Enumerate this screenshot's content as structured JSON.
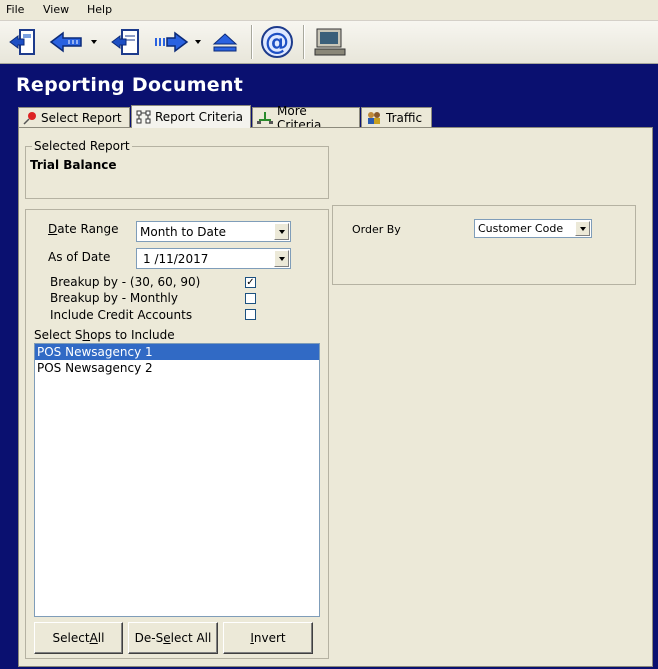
{
  "menu": [
    {
      "label": "File"
    },
    {
      "label": "View"
    },
    {
      "label": "Help"
    }
  ],
  "toolbar": {
    "icons": [
      "exit-icon",
      "back-icon",
      "dropdown-icon",
      "save-icon",
      "forward-icon",
      "dropdown-icon",
      "eject-icon",
      "email-icon",
      "monitor-icon"
    ]
  },
  "window": {
    "title": "Reporting Document"
  },
  "tabs": [
    {
      "label": "Select Report",
      "icon": "pin-icon",
      "active": false
    },
    {
      "label": "Report Criteria",
      "icon": "structure-icon",
      "active": true
    },
    {
      "label": "More Criteria",
      "icon": "tree-icon",
      "active": false
    },
    {
      "label": "Traffic",
      "icon": "people-icon",
      "active": false
    }
  ],
  "selected_report": {
    "group_label": "Selected Report",
    "value": "Trial Balance"
  },
  "criteria": {
    "date_range_label": "Date Range",
    "date_range_value": "Month to Date",
    "as_of_date_label": "As of Date",
    "as_of_date_value": "1 /11/2017",
    "breakup_306090_label": "Breakup by - (30, 60, 90)",
    "breakup_306090_checked": true,
    "breakup_monthly_label": "Breakup by - Monthly",
    "breakup_monthly_checked": false,
    "include_credit_label": "Include Credit Accounts",
    "include_credit_checked": false,
    "shops_label": "Select Shops to Include",
    "shops": [
      {
        "label": "POS Newsagency 1",
        "selected": true
      },
      {
        "label": "POS Newsagency 2",
        "selected": false
      }
    ],
    "select_all_label": "Select All",
    "deselect_all_label": "De-Select All",
    "invert_label": "Invert"
  },
  "order": {
    "label": "Order By",
    "value": "Customer Code"
  },
  "colors": {
    "header": "#0a1070",
    "selection": "#316ac5",
    "face": "#ece9d8"
  }
}
